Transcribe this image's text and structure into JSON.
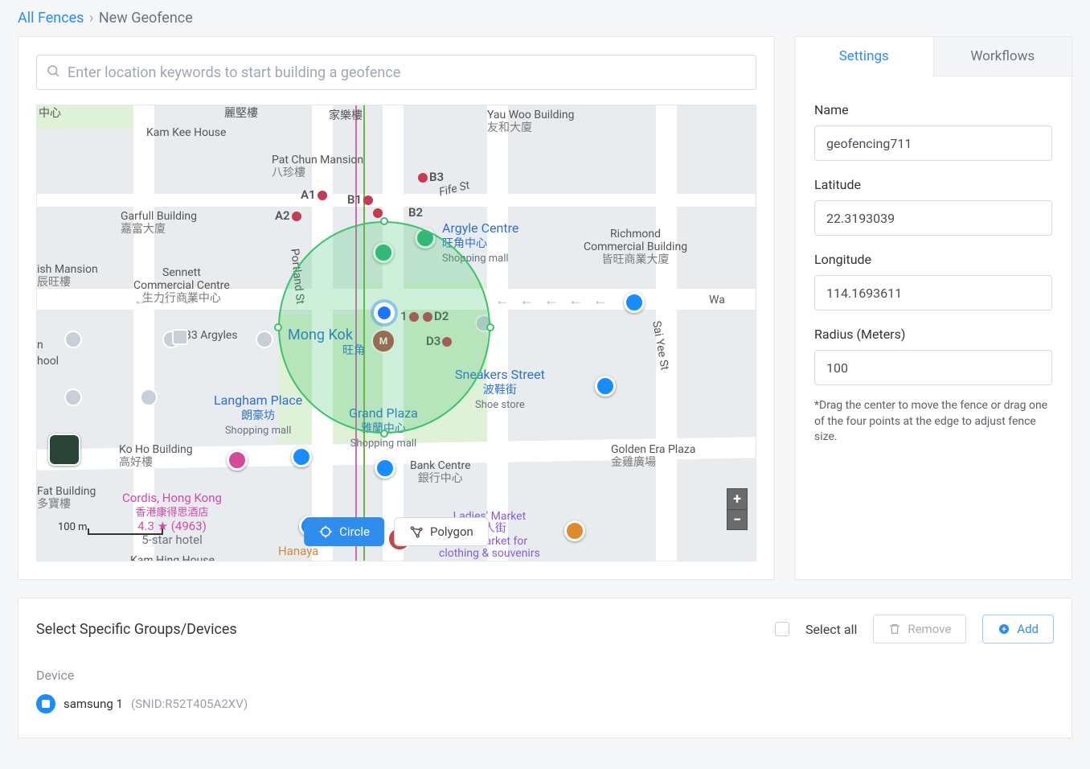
{
  "breadcrumb": {
    "parent": "All Fences",
    "current": "New Geofence"
  },
  "search": {
    "placeholder": "Enter location keywords to start building a geofence"
  },
  "toolButtons": {
    "circle": "Circle",
    "polygon": "Polygon"
  },
  "scale": {
    "label": "100 m"
  },
  "tabs": {
    "settings": "Settings",
    "workflows": "Workflows"
  },
  "form": {
    "name_label": "Name",
    "name_value": "geofencing711",
    "lat_label": "Latitude",
    "lat_value": "22.3193039",
    "lon_label": "Longitude",
    "lon_value": "114.1693611",
    "radius_label": "Radius (Meters)",
    "radius_value": "100",
    "hint": "*Drag the center to move the fence or drag one of the four points at the edge to adjust fence size."
  },
  "map": {
    "labels": {
      "argyle_centre": {
        "title": "Argyle Centre",
        "cn": "旺角中心",
        "type": "Shopping mall"
      },
      "mong_kok": "Mong Kok",
      "mong_kok_cn": "旺角",
      "langham": {
        "title": "Langham Place",
        "cn": "朗豪坊",
        "type": "Shopping mall"
      },
      "grand_plaza": {
        "title": "Grand Plaza",
        "cn": "雅蘭中心",
        "type": "Shopping mall"
      },
      "sneakers": {
        "title": "Sneakers Street",
        "cn": "波鞋街",
        "type": "Shoe store"
      },
      "fife": "Fife St",
      "portland": "Portland St",
      "sai_yee": "Sai Yee St",
      "bank_centre": {
        "title": "Bank Centre",
        "cn": "銀行中心"
      },
      "yau_woo": {
        "title": "Yau Woo Building",
        "cn": "友和大廈"
      },
      "kam_kee": "Kam Kee House",
      "pat_chun": {
        "title": "Pat Chun Mansion",
        "cn": "八珍樓"
      },
      "garfull": {
        "title": "Garfull Building",
        "cn": "嘉富大廈"
      },
      "richmond": {
        "title": "Richmond\nCommercial Building",
        "cn": "皆旺商業大廈"
      },
      "sennett": {
        "title": "Sennett\nCommercial Centre",
        "cn": "生力行商業中心"
      },
      "argyles33": "33 Argyles",
      "mansion": {
        "title": "ish Mansion",
        "cn": "辰旺樓"
      },
      "ko_ho": {
        "title": "Ko Ho Building",
        "cn": "高好樓"
      },
      "golden_era": {
        "title": "Golden Era Plaza",
        "cn": "金雞廣場"
      },
      "fat": {
        "title": "Fat Building",
        "cn": "多寶樓"
      },
      "cordis": {
        "title": "Cordis, Hong Kong",
        "cn": "香港康得思酒店",
        "rating": "4.3 ★ (4963)",
        "type": "5-star hotel"
      },
      "ladies": {
        "title": "Ladies' Market",
        "cn": "女人街",
        "l2": "Flea market for",
        "l3": "clothing & souvenirs"
      },
      "hanaya": "Hanaya",
      "hool": "hool",
      "kam_hing": "Kam Hing House",
      "wa": "Wa",
      "n_label": "n",
      "centre_cn": "中心",
      "laurel_house": "麗堅樓",
      "house_label": "家樂樓",
      "grid": {
        "a1": "A1",
        "a2": "A2",
        "b1": "B1",
        "b2": "B2",
        "b3": "B3",
        "d1": "1",
        "d2": "D2",
        "d3": "D3"
      }
    }
  },
  "devices": {
    "title": "Select Specific Groups/Devices",
    "select_all": "Select all",
    "remove": "Remove",
    "add": "Add",
    "section": "Device",
    "items": [
      {
        "name": "samsung 1",
        "snid": "(SNID:R52T405A2XV)"
      }
    ]
  }
}
